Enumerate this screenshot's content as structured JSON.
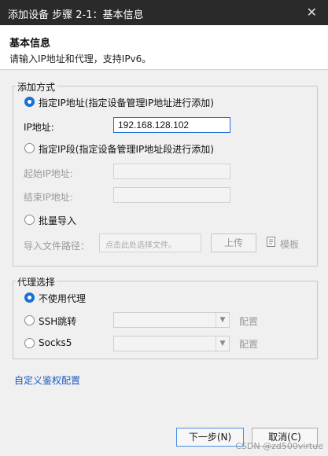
{
  "window": {
    "title": "添加设备 步骤 2-1：基本信息",
    "close_glyph": "✕"
  },
  "header": {
    "title": "基本信息",
    "subtitle": "请输入IP地址和代理，支持IPv6。"
  },
  "add_method": {
    "group_title": "添加方式",
    "option_ip": "指定IP地址(指定设备管理IP地址进行添加)",
    "ip_label": "IP地址:",
    "ip_value": "192.168.128.102",
    "option_range": "指定IP段(指定设备管理IP地址段进行添加)",
    "start_label": "起始IP地址:",
    "end_label": "结束IP地址:",
    "option_batch": "批量导入",
    "file_label": "导入文件路径：",
    "file_placeholder": "点击此处选择文件。",
    "upload_button": "上传",
    "template_link": "模板",
    "template_icon": "file-template-icon"
  },
  "proxy": {
    "group_title": "代理选择",
    "option_none": "不使用代理",
    "option_ssh": "SSH跳转",
    "ssh_config": "配置",
    "option_socks": "Socks5",
    "socks_config": "配置"
  },
  "custom_auth_link": "自定义鉴权配置",
  "footer": {
    "next_button": "下一步(N)",
    "cancel_button": "取消(C)"
  },
  "watermark": "CSDN @zd500virtue",
  "colors": {
    "accent": "#1a6fd8",
    "titlebar": "#2a2a2a",
    "link": "#1a57c4"
  }
}
